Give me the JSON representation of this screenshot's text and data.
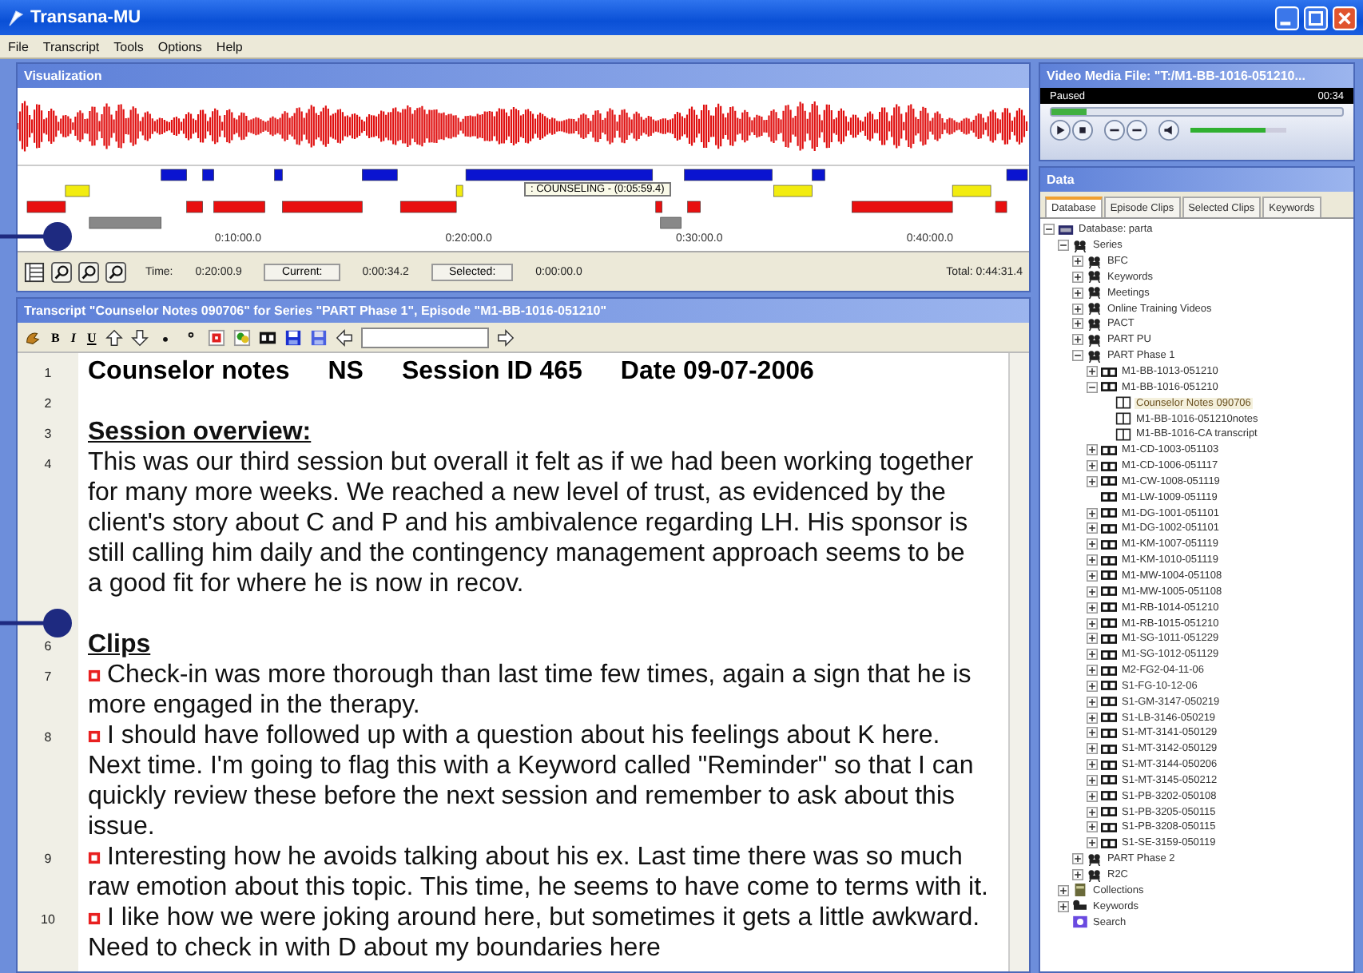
{
  "window": {
    "title": "Transana-MU"
  },
  "menu": [
    "File",
    "Transcript",
    "Tools",
    "Options",
    "Help"
  ],
  "visualization": {
    "title": "Visualization",
    "tooltip": ": COUNSELING -  (0:05:59.4)",
    "time_labels": [
      "0:10:00.0",
      "0:20:00.0",
      "0:30:00.0",
      "0:40:00.0"
    ],
    "time_label": "Time:",
    "time": "0:20:00.9",
    "current_button": "Current:",
    "current": "0:00:34.2",
    "selected_button": "Selected:",
    "selected": "0:00:00.0",
    "total": "Total:  0:44:31.4"
  },
  "transcript": {
    "title": "Transcript \"Counselor Notes 090706\" for Series \"PART Phase 1\", Episode \"M1-BB-1016-051210\"",
    "format_buttons": [
      "B",
      "I",
      "U"
    ],
    "lines": [
      {
        "number": "1",
        "kind": "header",
        "parts": [
          "Counselor notes",
          "NS",
          "Session ID 465",
          "Date 09-07-2006"
        ]
      },
      {
        "number": "2",
        "kind": "blank"
      },
      {
        "number": "3",
        "kind": "heading",
        "lines": [
          "Session overview:"
        ]
      },
      {
        "number": "4",
        "kind": "body",
        "lines": [
          "This was our third session but overall it felt as if we had been working together",
          "for many more weeks. We reached a new level of trust, as evidenced by the",
          "client's story about C and P and his ambivalence regarding LH. His sponsor is",
          "still calling him daily and the contingency management approach seems to be",
          "a good fit for where he is now in recov."
        ]
      },
      {
        "kind": "blank"
      },
      {
        "number": "6",
        "kind": "heading",
        "lines": [
          "Clips"
        ]
      },
      {
        "number": "7",
        "kind": "clip",
        "lines": [
          "Check-in was more thorough than last time few times, again a sign that he is",
          "more engaged in the therapy."
        ]
      },
      {
        "number": "8",
        "kind": "clip",
        "lines": [
          "I should have followed up with a question about his feelings about K here.",
          "Next time. I'm going to flag this with a Keyword called \"Reminder\" so that I can",
          "quickly review these before the next session and remember to ask about this",
          "issue."
        ]
      },
      {
        "number": "9",
        "kind": "clip",
        "lines": [
          "Interesting how he avoids talking about his ex. Last time there was so much",
          "raw emotion about this topic. This time, he seems to have come to terms with it."
        ]
      },
      {
        "number": "10",
        "kind": "clip",
        "lines": [
          "I like how we were joking around here, but sometimes it gets a little awkward.",
          "Need to check in with D about my boundaries here"
        ]
      }
    ]
  },
  "video": {
    "title": "Video Media File: \"T:/M1-BB-1016-051210...",
    "status": "Paused",
    "time": "00:34",
    "seek": {
      "level": 0.12
    },
    "volume": {
      "level": 0.78
    }
  },
  "data": {
    "title": "Data",
    "tabs": [
      {
        "label": "Database",
        "selected": true
      },
      {
        "label": "Episode Clips",
        "selected": false
      },
      {
        "label": "Selected Clips",
        "selected": false
      },
      {
        "label": "Keywords",
        "selected": false
      }
    ],
    "tree": [
      {
        "label": "Database: parta",
        "kind": "database",
        "selected": false,
        "expanded": true,
        "children": [
          {
            "label": "Series",
            "kind": "series",
            "selected": false,
            "expanded": true,
            "children": [
              {
                "label": "BFC",
                "kind": "series",
                "selected": false,
                "expanded": false
              },
              {
                "label": "Keywords",
                "kind": "series",
                "selected": false,
                "expanded": false
              },
              {
                "label": "Meetings",
                "kind": "series",
                "selected": false,
                "expanded": false
              },
              {
                "label": "Online Training Videos",
                "kind": "series",
                "selected": false,
                "expanded": false
              },
              {
                "label": "PACT",
                "kind": "series",
                "selected": false,
                "expanded": false
              },
              {
                "label": "PART PU",
                "kind": "series",
                "selected": false,
                "expanded": false
              },
              {
                "label": "PART Phase 1",
                "kind": "series",
                "selected": false,
                "expanded": true,
                "children": [
                  {
                    "label": "M1-BB-1013-051210",
                    "kind": "episode",
                    "selected": false,
                    "expanded": false
                  },
                  {
                    "label": "M1-BB-1016-051210",
                    "kind": "episode",
                    "selected": false,
                    "expanded": true,
                    "children": [
                      {
                        "label": "Counselor Notes 090706",
                        "kind": "transcript",
                        "selected": true
                      },
                      {
                        "label": "M1-BB-1016-051210notes",
                        "kind": "transcript",
                        "selected": false
                      },
                      {
                        "label": "M1-BB-1016-CA transcript",
                        "kind": "transcript",
                        "selected": false
                      }
                    ]
                  },
                  {
                    "label": "M1-CD-1003-051103",
                    "kind": "episode",
                    "selected": false,
                    "expanded": false
                  },
                  {
                    "label": "M1-CD-1006-051117",
                    "kind": "episode",
                    "selected": false,
                    "expanded": false
                  },
                  {
                    "label": "M1-CW-1008-051119",
                    "kind": "episode",
                    "selected": false,
                    "expanded": false
                  },
                  {
                    "label": "M1-LW-1009-051119",
                    "kind": "episode",
                    "selected": false
                  },
                  {
                    "label": "M1-DG-1001-051101",
                    "kind": "episode",
                    "selected": false,
                    "expanded": false
                  },
                  {
                    "label": "M1-DG-1002-051101",
                    "kind": "episode",
                    "selected": false,
                    "expanded": false
                  },
                  {
                    "label": "M1-KM-1007-051119",
                    "kind": "episode",
                    "selected": false,
                    "expanded": false
                  },
                  {
                    "label": "M1-KM-1010-051119",
                    "kind": "episode",
                    "selected": false,
                    "expanded": false
                  },
                  {
                    "label": "M1-MW-1004-051108",
                    "kind": "episode",
                    "selected": false,
                    "expanded": false
                  },
                  {
                    "label": "M1-MW-1005-051108",
                    "kind": "episode",
                    "selected": false,
                    "expanded": false
                  },
                  {
                    "label": "M1-RB-1014-051210",
                    "kind": "episode",
                    "selected": false,
                    "expanded": false
                  },
                  {
                    "label": "M1-RB-1015-051210",
                    "kind": "episode",
                    "selected": false,
                    "expanded": false
                  },
                  {
                    "label": "M1-SG-1011-051229",
                    "kind": "episode",
                    "selected": false,
                    "expanded": false
                  },
                  {
                    "label": "M1-SG-1012-051129",
                    "kind": "episode",
                    "selected": false,
                    "expanded": false
                  },
                  {
                    "label": "M2-FG2-04-11-06",
                    "kind": "episode",
                    "selected": false,
                    "expanded": false
                  },
                  {
                    "label": "S1-FG-10-12-06",
                    "kind": "episode",
                    "selected": false,
                    "expanded": false
                  },
                  {
                    "label": "S1-GM-3147-050219",
                    "kind": "episode",
                    "selected": false,
                    "expanded": false
                  },
                  {
                    "label": "S1-LB-3146-050219",
                    "kind": "episode",
                    "selected": false,
                    "expanded": false
                  },
                  {
                    "label": "S1-MT-3141-050129",
                    "kind": "episode",
                    "selected": false,
                    "expanded": false
                  },
                  {
                    "label": "S1-MT-3142-050129",
                    "kind": "episode",
                    "selected": false,
                    "expanded": false
                  },
                  {
                    "label": "S1-MT-3144-050206",
                    "kind": "episode",
                    "selected": false,
                    "expanded": false
                  },
                  {
                    "label": "S1-MT-3145-050212",
                    "kind": "episode",
                    "selected": false,
                    "expanded": false
                  },
                  {
                    "label": "S1-PB-3202-050108",
                    "kind": "episode",
                    "selected": false,
                    "expanded": false
                  },
                  {
                    "label": "S1-PB-3205-050115",
                    "kind": "episode",
                    "selected": false,
                    "expanded": false
                  },
                  {
                    "label": "S1-PB-3208-050115",
                    "kind": "episode",
                    "selected": false,
                    "expanded": false
                  },
                  {
                    "label": "S1-SE-3159-050119",
                    "kind": "episode",
                    "selected": false,
                    "expanded": false
                  }
                ]
              },
              {
                "label": "PART Phase 2",
                "kind": "series",
                "selected": false,
                "expanded": false
              },
              {
                "label": "R2C",
                "kind": "series",
                "selected": false,
                "expanded": false
              }
            ]
          },
          {
            "label": "Collections",
            "kind": "collections",
            "selected": false,
            "expanded": false
          },
          {
            "label": "Keywords",
            "kind": "keywords",
            "selected": false,
            "expanded": false
          },
          {
            "label": "Search",
            "kind": "search",
            "selected": false
          }
        ]
      }
    ]
  }
}
